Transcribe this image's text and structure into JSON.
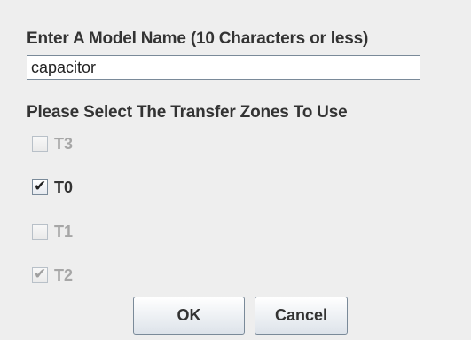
{
  "model_name": {
    "label": "Enter A Model Name (10 Characters or less)",
    "value": "capacitor"
  },
  "zones": {
    "label": "Please Select The Transfer Zones To Use",
    "items": [
      {
        "label": "T3",
        "checked": false,
        "enabled": false
      },
      {
        "label": "T0",
        "checked": true,
        "enabled": true
      },
      {
        "label": "T1",
        "checked": false,
        "enabled": false
      },
      {
        "label": "T2",
        "checked": true,
        "enabled": false
      }
    ]
  },
  "buttons": {
    "ok": "OK",
    "cancel": "Cancel"
  }
}
